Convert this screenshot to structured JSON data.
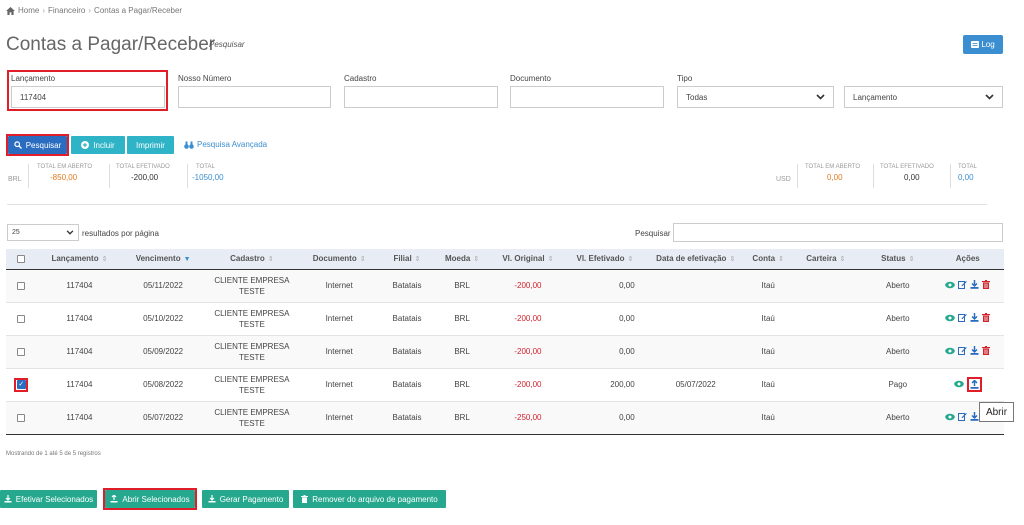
{
  "breadcrumb": {
    "home": "Home",
    "financeiro": "Financeiro",
    "current": "Contas a Pagar/Receber"
  },
  "page": {
    "title": "Contas a Pagar/Receber",
    "search_link": "Pesquisar",
    "log_label": "Log"
  },
  "filters": {
    "lancamento": {
      "label": "Lançamento",
      "value": "117404"
    },
    "nosso_numero": {
      "label": "Nosso Número",
      "value": ""
    },
    "cadastro": {
      "label": "Cadastro",
      "value": ""
    },
    "documento": {
      "label": "Documento",
      "value": ""
    },
    "tipo": {
      "label": "Tipo",
      "value": "Todas"
    },
    "ordem": {
      "value": "Lançamento"
    }
  },
  "toolbar": {
    "pesquisar": "Pesquisar",
    "incluir": "Incluir",
    "imprimir": "Imprimir",
    "avancada": "Pesquisa Avançada"
  },
  "totals": {
    "brl": {
      "currency": "BRL",
      "aberto_label": "TOTAL EM ABERTO",
      "aberto": "-850,00",
      "efetivado_label": "TOTAL EFETIVADO",
      "efetivado": "-200,00",
      "total_label": "TOTAL",
      "total": "-1050,00"
    },
    "usd": {
      "currency": "USD",
      "aberto_label": "TOTAL EM ABERTO",
      "aberto": "0,00",
      "efetivado_label": "TOTAL EFETIVADO",
      "efetivado": "0,00",
      "total_label": "TOTAL",
      "total": "0,00"
    }
  },
  "table_controls": {
    "page_size": "25",
    "page_size_label": "resultados por página",
    "search_label": "Pesquisar",
    "search_value": ""
  },
  "table": {
    "headers": [
      "Lançamento",
      "Vencimento",
      "Cadastro",
      "Documento",
      "Filial",
      "Moeda",
      "Vl. Original",
      "Vl. Efetivado",
      "Data de efetivação",
      "Conta",
      "Carteira",
      "Status",
      "Ações"
    ],
    "rows": [
      {
        "lancamento": "117404",
        "vencimento": "05/11/2022",
        "cadastro": "CLIENTE EMPRESA TESTE",
        "documento": "Internet",
        "filial": "Batatais",
        "moeda": "BRL",
        "original": "-200,00",
        "efetivado": "0,00",
        "data_efet": "",
        "conta": "Itaú",
        "carteira": "",
        "status": "Aberto",
        "checked": false
      },
      {
        "lancamento": "117404",
        "vencimento": "05/10/2022",
        "cadastro": "CLIENTE EMPRESA TESTE",
        "documento": "Internet",
        "filial": "Batatais",
        "moeda": "BRL",
        "original": "-200,00",
        "efetivado": "0,00",
        "data_efet": "",
        "conta": "Itaú",
        "carteira": "",
        "status": "Aberto",
        "checked": false
      },
      {
        "lancamento": "117404",
        "vencimento": "05/09/2022",
        "cadastro": "CLIENTE EMPRESA TESTE",
        "documento": "Internet",
        "filial": "Batatais",
        "moeda": "BRL",
        "original": "-200,00",
        "efetivado": "0,00",
        "data_efet": "",
        "conta": "Itaú",
        "carteira": "",
        "status": "Aberto",
        "checked": false
      },
      {
        "lancamento": "117404",
        "vencimento": "05/08/2022",
        "cadastro": "CLIENTE EMPRESA TESTE",
        "documento": "Internet",
        "filial": "Batatais",
        "moeda": "BRL",
        "original": "-200,00",
        "efetivado": "200,00",
        "data_efet": "05/07/2022",
        "conta": "Itaú",
        "carteira": "",
        "status": "Pago",
        "checked": true
      },
      {
        "lancamento": "117404",
        "vencimento": "05/07/2022",
        "cadastro": "CLIENTE EMPRESA TESTE",
        "documento": "Internet",
        "filial": "Batatais",
        "moeda": "BRL",
        "original": "-250,00",
        "efetivado": "0,00",
        "data_efet": "",
        "conta": "Itaú",
        "carteira": "",
        "status": "Aberto",
        "checked": false
      }
    ]
  },
  "tooltip": "Abrir",
  "footer_note": "Mostrando de 1 até 5 de 5 registros",
  "bottom_buttons": {
    "efetivar": "Efetivar Selecionados",
    "abrir": "Abrir Selecionados",
    "gerar": "Gerar Pagamento",
    "remover": "Remover do arquivo de pagamento"
  },
  "colors": {
    "primary": "#2a6cbf",
    "teal": "#2fb3c6",
    "green": "#25a88e",
    "negative": "#d2222d",
    "highlight": "#e11d2a"
  }
}
